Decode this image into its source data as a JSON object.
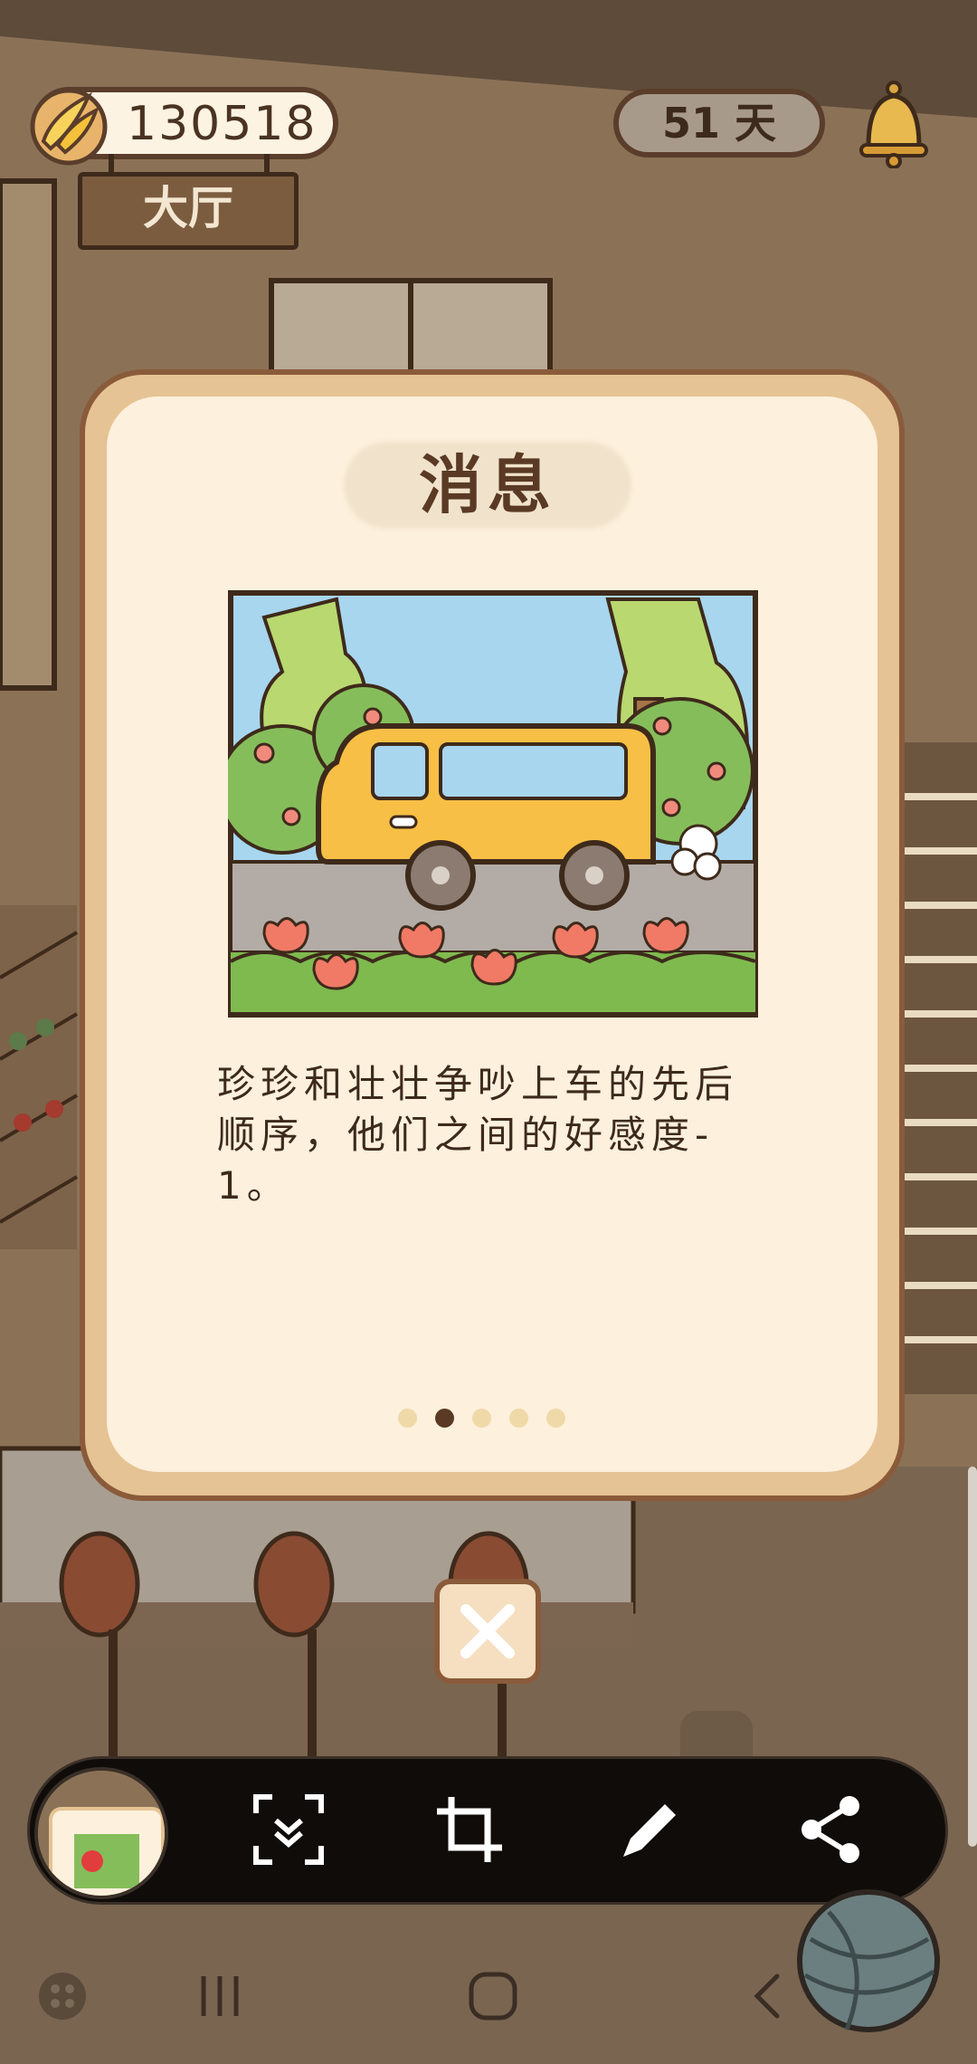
{
  "hud": {
    "banana_count": "130518",
    "location_sign": "大厅",
    "days": "51 天"
  },
  "dialog": {
    "title": "消息",
    "message": "珍珍和壮壮争吵上车的先后顺序，他们之间的好感度-1。",
    "pager": {
      "total": 5,
      "current": 2
    }
  },
  "icons": {
    "banana": "banana-icon",
    "bell": "bell-icon",
    "close": "close-icon",
    "scroll_capture": "scroll-capture-icon",
    "crop": "crop-icon",
    "draw": "pencil-icon",
    "share": "share-icon",
    "nav_recents": "recents-icon",
    "nav_home": "home-icon",
    "nav_back": "back-icon"
  },
  "colors": {
    "dialog_frame": "#e5c394",
    "dialog_body": "#fdf0dc",
    "text_brown": "#3d2a1c",
    "van_yellow": "#f7bf45",
    "toolbar_bg": "#100c09"
  }
}
